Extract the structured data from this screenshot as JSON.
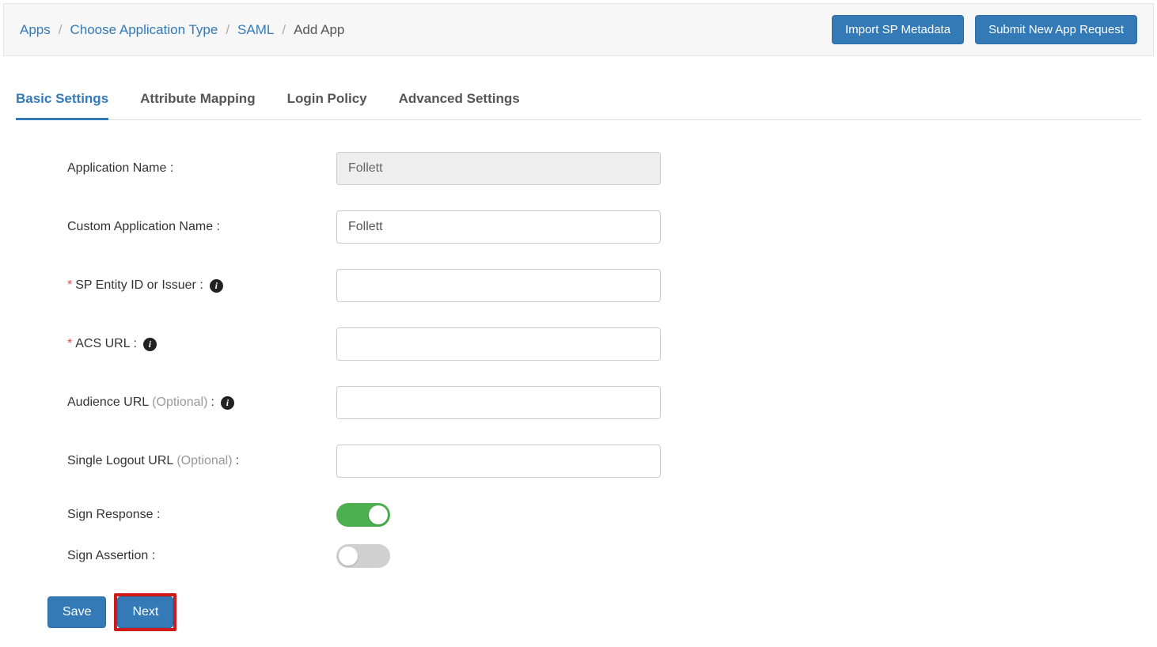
{
  "breadcrumb": {
    "apps": "Apps",
    "choose_type": "Choose Application Type",
    "saml": "SAML",
    "current": "Add App"
  },
  "header_buttons": {
    "import": "Import SP Metadata",
    "submit_request": "Submit New App Request"
  },
  "tabs": {
    "basic": "Basic Settings",
    "attribute": "Attribute Mapping",
    "login": "Login Policy",
    "advanced": "Advanced Settings"
  },
  "form": {
    "app_name_label": "Application Name :",
    "app_name_value": "Follett",
    "custom_app_name_label": "Custom Application Name :",
    "custom_app_name_value": "Follett",
    "sp_entity_label": "SP Entity ID or Issuer :",
    "sp_entity_value": "",
    "acs_url_label": "ACS URL :",
    "acs_url_value": "",
    "audience_url_label_pre": "Audience URL ",
    "audience_url_optional": "(Optional)",
    "audience_url_label_post": " :",
    "audience_url_value": "",
    "slo_label_pre": "Single Logout URL ",
    "slo_optional": "(Optional)",
    "slo_label_post": " :",
    "slo_value": "",
    "sign_response_label": "Sign Response :",
    "sign_response_on": true,
    "sign_assertion_label": "Sign Assertion :",
    "sign_assertion_on": false,
    "required_mark": "*"
  },
  "footer": {
    "save": "Save",
    "next": "Next"
  }
}
